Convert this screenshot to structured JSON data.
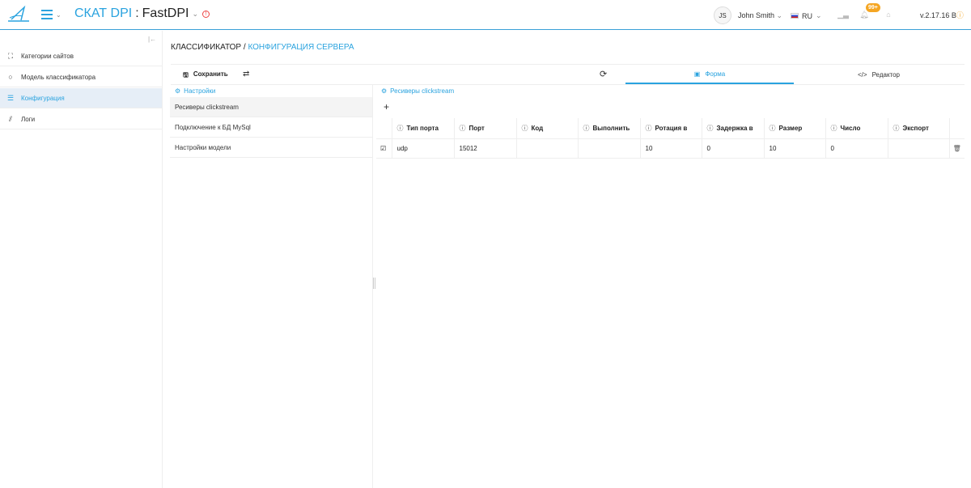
{
  "header": {
    "brand": "СКАТ DPI",
    "separator": ":",
    "app": "FastDPI",
    "avatar_initials": "JS",
    "user_name": "John Smith",
    "language": "RU",
    "notifications_badge": "99+",
    "version": "v.2.17.16 B",
    "accent_color": "#2aa3df"
  },
  "sidebar": {
    "items": [
      {
        "label": "Категории сайтов",
        "icon": "sitemap-icon"
      },
      {
        "label": "Модель классификатора",
        "icon": "circle-icon"
      },
      {
        "label": "Конфигурация",
        "icon": "list-icon"
      },
      {
        "label": "Логи",
        "icon": "chart-icon"
      }
    ],
    "active_index": 2
  },
  "breadcrumb": {
    "parent": "КЛАССИФИКАТОР",
    "separator": "/",
    "current": "КОНФИГУРАЦИЯ СЕРВЕРА"
  },
  "toolbar": {
    "save_label": "Сохранить",
    "tab_form": "Форма",
    "tab_editor": "Редактор",
    "active_tab": "Форма"
  },
  "settings_panel": {
    "title": "Настройки",
    "items": [
      "Ресиверы clickstream",
      "Подключение к БД MySql",
      "Настройки модели"
    ],
    "active_index": 0
  },
  "receivers_panel": {
    "title": "Ресиверы clickstream",
    "columns": [
      "Тип порта",
      "Порт",
      "Код",
      "Выполнить",
      "Ротация в",
      "Задержка в",
      "Размер",
      "Число",
      "Экспорт"
    ],
    "rows": [
      {
        "checked": true,
        "cells": [
          "udp",
          "15012",
          "",
          "",
          "10",
          "0",
          "10",
          "0",
          ""
        ]
      }
    ]
  }
}
